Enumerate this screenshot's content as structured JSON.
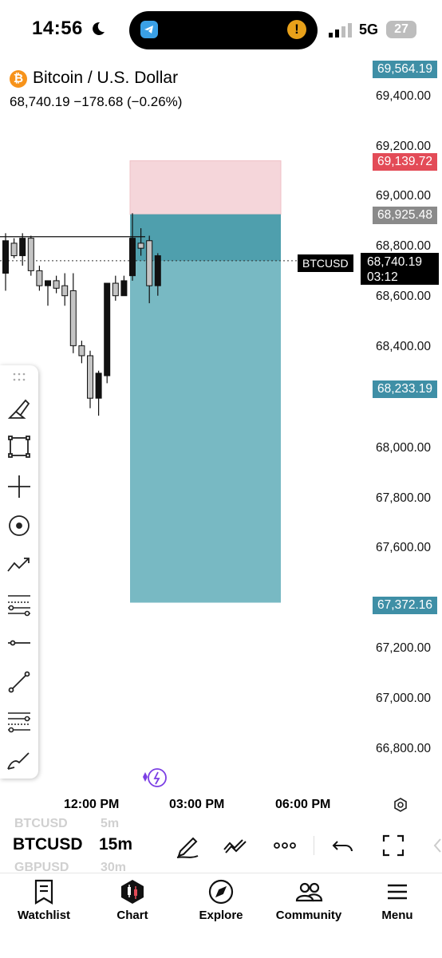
{
  "status_bar": {
    "time": "14:56",
    "network": "5G",
    "battery": "27"
  },
  "header": {
    "title": "Bitcoin / U.S. Dollar",
    "price_line": "68,740.19  −178.68 (−0.26%)"
  },
  "price_axis": {
    "ticks": [
      "69,400.00",
      "69,200.00",
      "69,000.00",
      "68,800.00",
      "68,600.00",
      "68,400.00",
      "68,000.00",
      "67,800.00",
      "67,600.00",
      "67,200.00",
      "67,000.00",
      "66,800.00"
    ],
    "tags": [
      {
        "label": "69,564.19",
        "color": "#3f8fa6"
      },
      {
        "label": "69,139.72",
        "color": "#e34b57"
      },
      {
        "label": "68,925.48",
        "color": "#8a8a8a"
      },
      {
        "label": "68,233.19",
        "color": "#3f8fa6"
      },
      {
        "label": "67,372.16",
        "color": "#3f8fa6"
      }
    ],
    "current": {
      "symbol": "BTCUSD",
      "price": "68,740.19",
      "countdown": "03:12"
    }
  },
  "time_axis": [
    "12:00 PM",
    "03:00 PM",
    "06:00 PM"
  ],
  "toolbar_tools": [
    "brush-icon",
    "rectangle-icon",
    "crosshair-icon",
    "circle-icon",
    "trend-icon",
    "fib-icon",
    "horizontal-line-icon",
    "line-icon",
    "levels-icon",
    "pen-icon"
  ],
  "symbol_bar": {
    "prev_symbol": "BTCUSD",
    "prev_interval": "5m",
    "symbol": "BTCUSD",
    "interval": "15m",
    "next_symbol": "GBPUSD",
    "next_interval": "30m"
  },
  "nav": [
    {
      "label": "Watchlist",
      "icon": "watchlist-icon"
    },
    {
      "label": "Chart",
      "icon": "chart-icon"
    },
    {
      "label": "Explore",
      "icon": "compass-icon"
    },
    {
      "label": "Community",
      "icon": "community-icon"
    },
    {
      "label": "Menu",
      "icon": "menu-icon"
    }
  ],
  "chart_data": {
    "type": "candlestick",
    "title": "Bitcoin / U.S. Dollar",
    "ylim": [
      66700,
      69600
    ],
    "candles": [
      {
        "o": 68690,
        "h": 68850,
        "l": 68620,
        "c": 68820
      },
      {
        "o": 68810,
        "h": 68830,
        "l": 68750,
        "c": 68760
      },
      {
        "o": 68760,
        "h": 68850,
        "l": 68720,
        "c": 68830
      },
      {
        "o": 68830,
        "h": 68840,
        "l": 68680,
        "c": 68700
      },
      {
        "o": 68700,
        "h": 68720,
        "l": 68620,
        "c": 68640
      },
      {
        "o": 68640,
        "h": 68660,
        "l": 68560,
        "c": 68660
      },
      {
        "o": 68660,
        "h": 68680,
        "l": 68610,
        "c": 68630
      },
      {
        "o": 68640,
        "h": 68690,
        "l": 68560,
        "c": 68600
      },
      {
        "o": 68620,
        "h": 68690,
        "l": 68370,
        "c": 68400
      },
      {
        "o": 68400,
        "h": 68420,
        "l": 68330,
        "c": 68360
      },
      {
        "o": 68360,
        "h": 68380,
        "l": 68150,
        "c": 68190
      },
      {
        "o": 68190,
        "h": 68300,
        "l": 68120,
        "c": 68290
      },
      {
        "o": 68280,
        "h": 68650,
        "l": 68250,
        "c": 68650
      },
      {
        "o": 68650,
        "h": 68680,
        "l": 68580,
        "c": 68600
      },
      {
        "o": 68600,
        "h": 68680,
        "l": 68600,
        "c": 68660
      },
      {
        "o": 68680,
        "h": 68930,
        "l": 68660,
        "c": 68830
      },
      {
        "o": 68810,
        "h": 68870,
        "l": 68760,
        "c": 68790
      },
      {
        "o": 68820,
        "h": 68840,
        "l": 68570,
        "c": 68640
      },
      {
        "o": 68640,
        "h": 68770,
        "l": 68600,
        "c": 68760
      }
    ],
    "position": {
      "entry": 68925.48,
      "stop": 69139.72,
      "target": 67372.16,
      "high_marker": 69564.19,
      "low_marker": 68233.19
    },
    "horizontal_line": 68836
  }
}
